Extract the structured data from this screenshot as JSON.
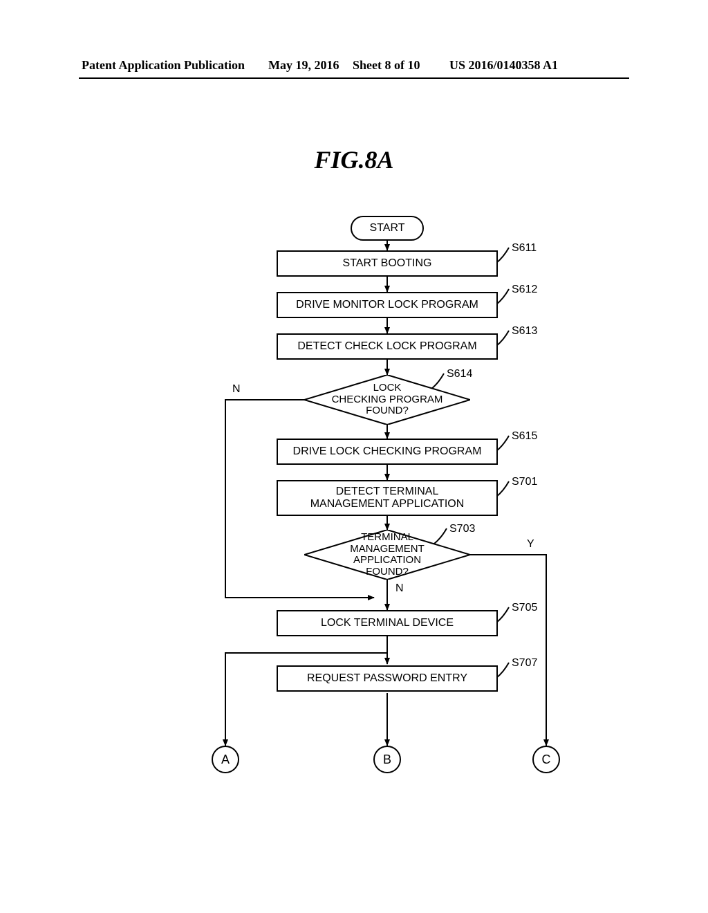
{
  "header": {
    "left": "Patent Application Publication",
    "date": "May 19, 2016",
    "sheet": "Sheet 8 of 10",
    "pubno": "US 2016/0140358 A1"
  },
  "figure_label": "FIG.8A",
  "steps": {
    "start": "START",
    "s611": {
      "code": "S611",
      "text": "START BOOTING"
    },
    "s612": {
      "code": "S612",
      "text": "DRIVE MONITOR LOCK PROGRAM"
    },
    "s613": {
      "code": "S613",
      "text": "DETECT CHECK LOCK PROGRAM"
    },
    "s614": {
      "code": "S614",
      "text": "LOCK\nCHECKING PROGRAM\nFOUND?"
    },
    "s615": {
      "code": "S615",
      "text": "DRIVE LOCK CHECKING PROGRAM"
    },
    "s701": {
      "code": "S701",
      "text": "DETECT TERMINAL\nMANAGEMENT APPLICATION"
    },
    "s703": {
      "code": "S703",
      "text": "TERMINAL\nMANAGEMENT APPLICATION\nFOUND?"
    },
    "s705": {
      "code": "S705",
      "text": "LOCK TERMINAL DEVICE"
    },
    "s707": {
      "code": "S707",
      "text": "REQUEST PASSWORD ENTRY"
    }
  },
  "edges": {
    "s614_no": "N",
    "s703_yes": "Y",
    "s703_no": "N"
  },
  "connectors": {
    "A": "A",
    "B": "B",
    "C": "C"
  }
}
